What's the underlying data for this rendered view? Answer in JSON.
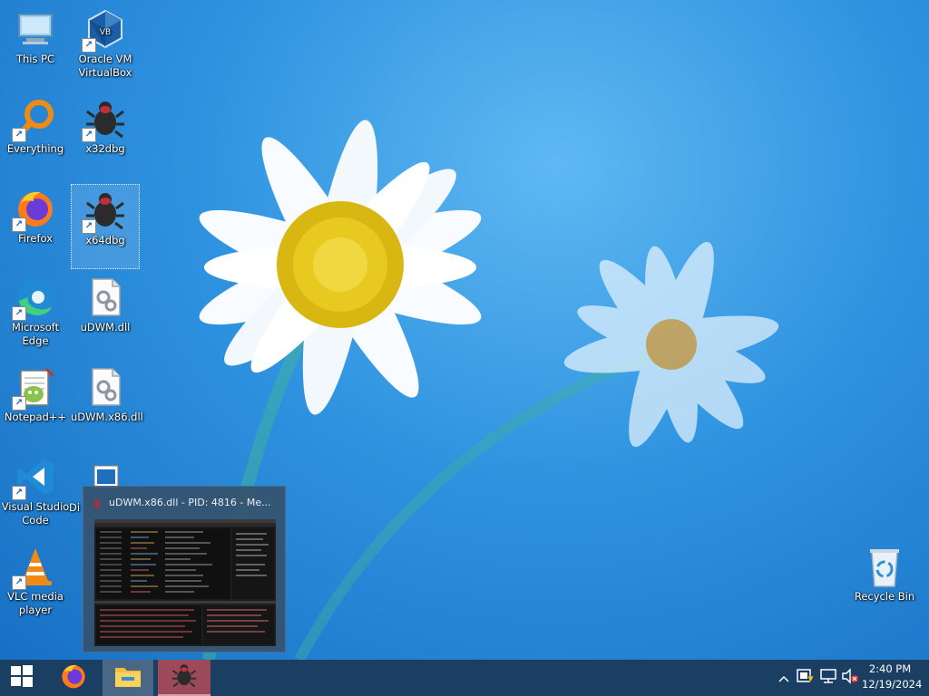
{
  "desktop": {
    "icons": [
      {
        "label": "This PC",
        "icon": "this-pc-icon"
      },
      {
        "label": "Oracle VM VirtualBox",
        "icon": "virtualbox-icon"
      },
      {
        "label": "Everything",
        "icon": "everything-search-icon"
      },
      {
        "label": "x32dbg",
        "icon": "x32dbg-bug-icon"
      },
      {
        "label": "Firefox",
        "icon": "firefox-icon"
      },
      {
        "label": "x64dbg",
        "icon": "x64dbg-bug-icon",
        "selected": true
      },
      {
        "label": "Microsoft Edge",
        "icon": "edge-icon"
      },
      {
        "label": "uDWM.dll",
        "icon": "dll-file-icon"
      },
      {
        "label": "Notepad++",
        "icon": "notepadpp-icon"
      },
      {
        "label": "uDWM.x86.dll",
        "icon": "dll-file-icon"
      },
      {
        "label": "Visual Studio Code",
        "icon": "vscode-icon"
      },
      {
        "label": "Di",
        "icon": "document-icon"
      },
      {
        "label": "VLC media player",
        "icon": "vlc-icon"
      },
      {
        "label": "Recycle Bin",
        "icon": "recycle-bin-icon"
      }
    ]
  },
  "preview": {
    "title": "uDWM.x86.dll - PID: 4816 - Me..."
  },
  "taskbar": {
    "start": "start-icon",
    "pinned": [
      {
        "name": "Firefox",
        "icon": "firefox-icon"
      },
      {
        "name": "File Explorer",
        "icon": "folder-icon"
      },
      {
        "name": "x64dbg",
        "icon": "x64dbg-bug-icon"
      }
    ],
    "tray": {
      "icons": [
        "chevron-up-icon",
        "security-warning-icon",
        "network-icon",
        "volume-muted-icon"
      ],
      "time": "2:40 PM",
      "date": "12/19/2024"
    }
  },
  "colors": {
    "taskbar": "#1a3f63",
    "desktop": "#2f93e0",
    "debugger_accent": "#9c4a5a"
  }
}
